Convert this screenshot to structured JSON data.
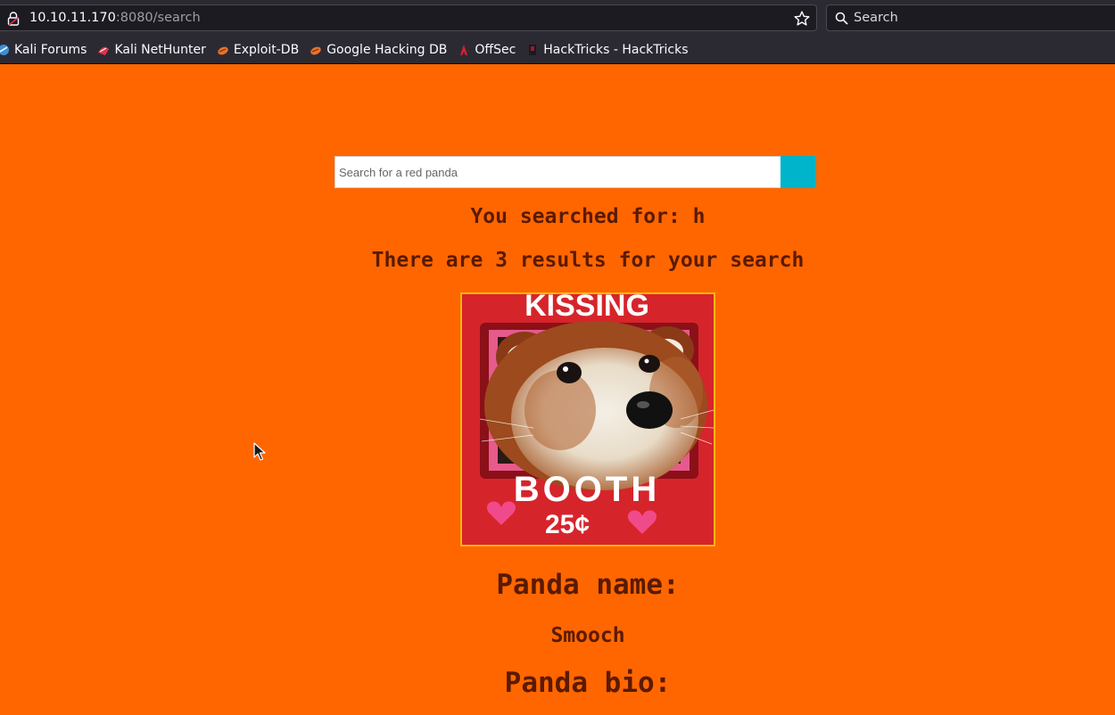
{
  "browser": {
    "url_host": "10.10.11.170",
    "url_path": ":8080/search",
    "search_placeholder": "Search",
    "bookmarks": [
      {
        "label": "Kali Forums",
        "icon": "kali-forums-icon",
        "color": "#3a8fd8"
      },
      {
        "label": "Kali NetHunter",
        "icon": "nethunter-icon",
        "color": "#e0334a"
      },
      {
        "label": "Exploit-DB",
        "icon": "exploit-db-icon",
        "color": "#e8722c"
      },
      {
        "label": "Google Hacking DB",
        "icon": "ghdb-icon",
        "color": "#e8722c"
      },
      {
        "label": "OffSec",
        "icon": "offsec-icon",
        "color": "#d8202e"
      },
      {
        "label": "HackTricks - HackTricks",
        "icon": "hacktricks-icon",
        "color": "#b01030"
      }
    ]
  },
  "page": {
    "background": "#ff6600",
    "text_color": "#5a1a00",
    "search_placeholder": "Search for a red panda",
    "search_button_color": "#00b4cc",
    "searched_for": "You searched for: h",
    "results_count": "There are 3 results for your search",
    "image_text_top": "KISSING",
    "image_text_bottom": "BOOTH",
    "image_price": "25¢",
    "panda_name_heading": "Panda name:",
    "panda_name": "Smooch",
    "panda_bio_heading": "Panda bio:"
  }
}
